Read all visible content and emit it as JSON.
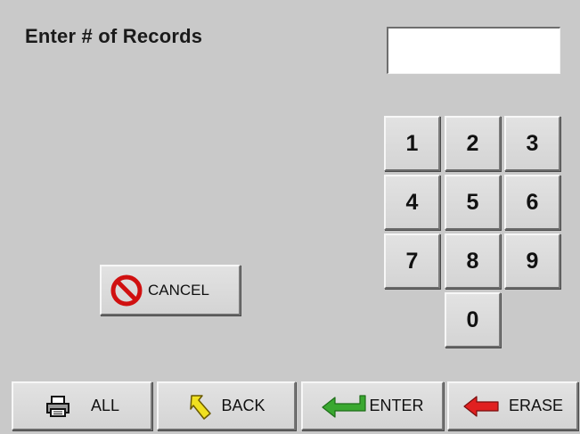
{
  "header": {
    "title": "Enter # of Records"
  },
  "entry_field": {
    "value": ""
  },
  "keypad": {
    "keys": [
      "1",
      "2",
      "3",
      "4",
      "5",
      "6",
      "7",
      "8",
      "9",
      "0"
    ]
  },
  "actions": {
    "cancel_label": "CANCEL",
    "all_label": "ALL",
    "back_label": "BACK",
    "enter_label": "ENTER",
    "erase_label": "ERASE"
  },
  "icons": {
    "cancel": "prohibited-icon",
    "all": "printer-icon",
    "back": "back-arrow-icon",
    "enter": "enter-arrow-icon",
    "erase": "erase-arrow-icon"
  },
  "colors": {
    "background": "#c9c9c9",
    "cancel_red": "#d01010",
    "back_yellow": "#f0e020",
    "enter_green": "#3aa830",
    "erase_red": "#e02020"
  }
}
